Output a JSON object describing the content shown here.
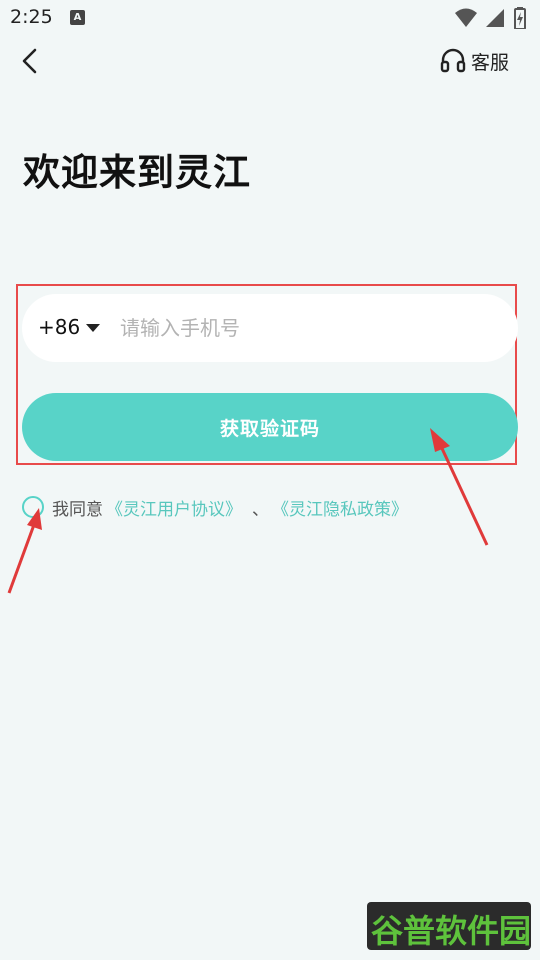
{
  "status_bar": {
    "time": "2:25",
    "notification_icon": "A"
  },
  "header": {
    "back_icon": "chevron-left-icon",
    "service_icon": "headset-icon",
    "service_label": "客服"
  },
  "main": {
    "title": "欢迎来到灵江",
    "country_code": "+86",
    "phone_placeholder": "请输入手机号",
    "phone_value": "",
    "get_code_label": "获取验证码",
    "agreement": {
      "prefix": "我同意",
      "user_agreement": "《灵江用户协议》",
      "separator": "、",
      "privacy_policy": "《灵江隐私政策》",
      "checked": false
    }
  },
  "watermark": {
    "text": "谷普软件园"
  },
  "colors": {
    "accent": "#58d3c8",
    "link": "#58c7bd",
    "background": "#f2f7f7",
    "highlight_box": "#e84b4b"
  }
}
